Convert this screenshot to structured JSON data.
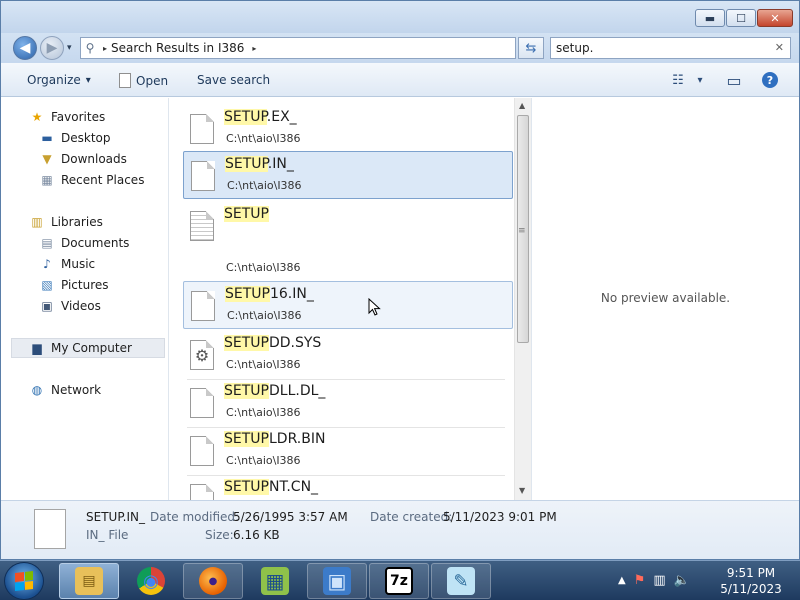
{
  "window": {
    "buttons": {
      "minimize": "▬",
      "maximize": "☐",
      "close": "✕"
    }
  },
  "address": {
    "back_glyph": "◀",
    "forward_glyph": "▶",
    "dropdown_glyph": "▾",
    "search_glyph": "⚲",
    "separator": "▸",
    "breadcrumb": "Search Results in I386",
    "refresh_glyph": "⇆"
  },
  "search": {
    "value": "setup.",
    "clear": "✕"
  },
  "toolbar": {
    "organize_label": "Organize",
    "organize_arrow": "▾",
    "open_label": "Open",
    "save_search_label": "Save search",
    "views_glyph": "☷",
    "views_arrow": "▾",
    "preview_pane_glyph": "▭",
    "help_glyph": "?"
  },
  "nav": {
    "favorites": "Favorites",
    "desktop": "Desktop",
    "downloads": "Downloads",
    "recent_places": "Recent Places",
    "libraries": "Libraries",
    "documents": "Documents",
    "music": "Music",
    "pictures": "Pictures",
    "videos": "Videos",
    "my_computer": "My Computer",
    "network": "Network"
  },
  "files": [
    {
      "match": "SETUP",
      "rest": ".EX_",
      "path": "C:\\nt\\aio\\I386"
    },
    {
      "match": "SETUP",
      "rest": ".IN_",
      "path": "C:\\nt\\aio\\I386"
    },
    {
      "match": "SETUP",
      "rest": "",
      "path": "C:\\nt\\aio\\I386"
    },
    {
      "match": "SETUP",
      "rest": "16.IN_",
      "path": "C:\\nt\\aio\\I386"
    },
    {
      "match": "SETUP",
      "rest": "DD.SYS",
      "path": "C:\\nt\\aio\\I386"
    },
    {
      "match": "SETUP",
      "rest": "DLL.DL_",
      "path": "C:\\nt\\aio\\I386"
    },
    {
      "match": "SETUP",
      "rest": "LDR.BIN",
      "path": "C:\\nt\\aio\\I386"
    },
    {
      "match": "SETUP",
      "rest": "NT.CN_",
      "path": ""
    }
  ],
  "scrollbar": {
    "up": "▲",
    "down": "▼",
    "grip": "≡"
  },
  "preview": {
    "message": "No preview available."
  },
  "details": {
    "name": "SETUP.IN_",
    "type": "IN_ File",
    "date_modified_label": "Date modified:",
    "date_modified": "5/26/1995 3:57 AM",
    "size_label": "Size:",
    "size": "6.16 KB",
    "date_created_label": "Date created:",
    "date_created": "5/11/2023 9:01 PM"
  },
  "taskbar": {
    "apps": [
      {
        "name": "explorer",
        "glyph": "▤"
      },
      {
        "name": "chrome",
        "glyph": "◉"
      },
      {
        "name": "firefox",
        "glyph": "●"
      },
      {
        "name": "installer",
        "glyph": "▦"
      },
      {
        "name": "control-panel",
        "glyph": "▣"
      },
      {
        "name": "7zip",
        "glyph": "7z"
      },
      {
        "name": "notepad",
        "glyph": "✎"
      }
    ],
    "tray": {
      "show_hidden": "▲",
      "action_center": "⚑",
      "network": "▥",
      "volume": "🔈"
    },
    "clock_time": "9:51 PM",
    "clock_date": "5/11/2023"
  },
  "colors": {
    "highlight": "#fff8a8",
    "selection": "#dbe8f7",
    "accent": "#2f6fc0"
  }
}
